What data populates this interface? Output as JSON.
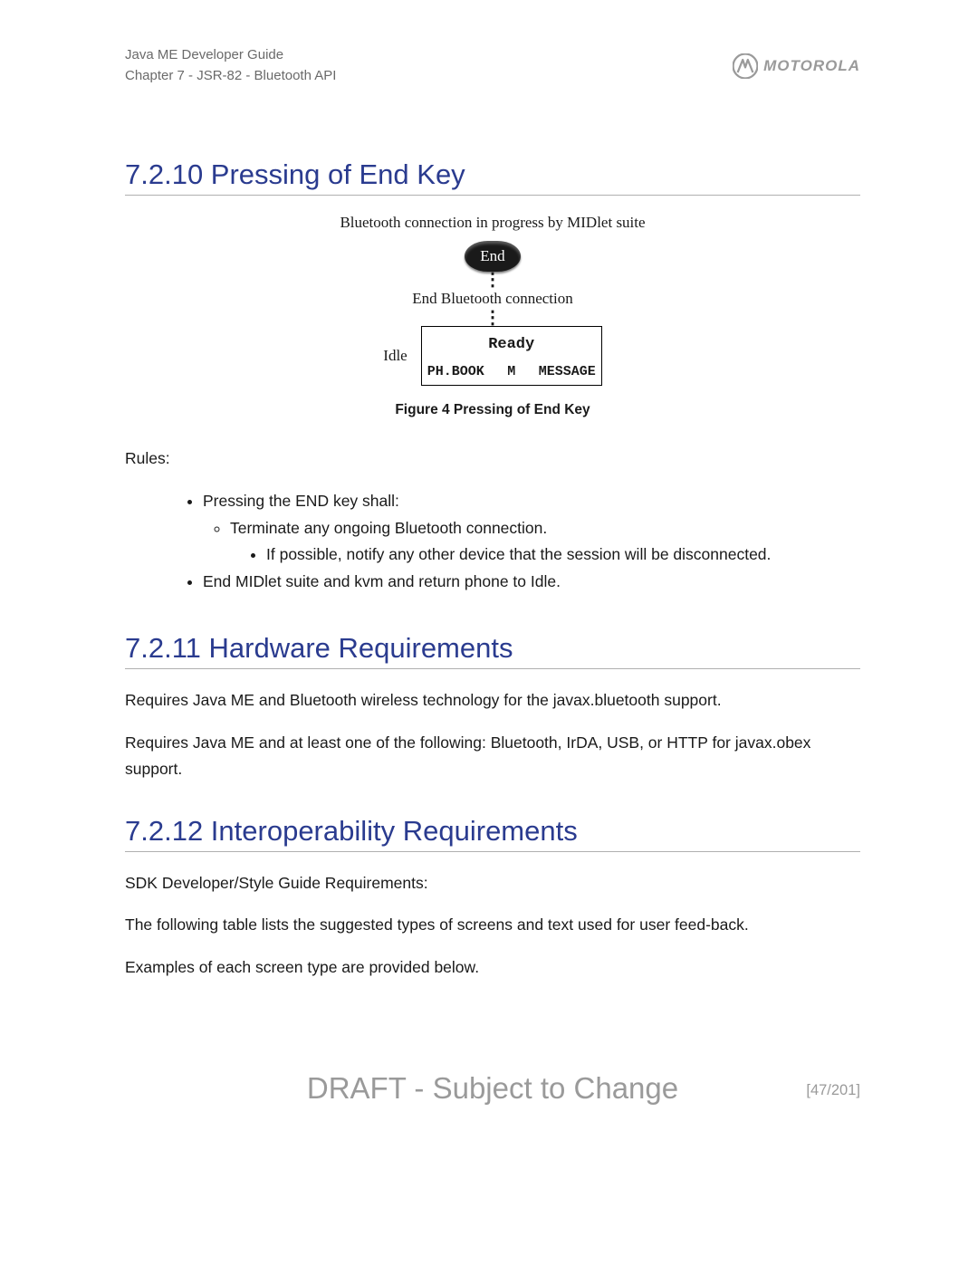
{
  "header": {
    "line1": "Java ME Developer Guide",
    "line2": "Chapter 7 - JSR-82 - Bluetooth API",
    "logo_text": "MOTOROLA"
  },
  "s1": {
    "heading": "7.2.10 Pressing of End Key",
    "fig_top": "Bluetooth connection in progress by MIDlet suite",
    "end_btn": "End",
    "fig_mid": "End Bluetooth connection",
    "idle": "Idle",
    "screen_r1": "Ready",
    "screen_r2a": "PH.BOOK",
    "screen_r2b": "M",
    "screen_r2c": "MESSAGE",
    "caption": "Figure 4 Pressing of End Key",
    "rules_label": "Rules:",
    "b1": "Pressing the END key shall:",
    "b1a": "Terminate any ongoing Bluetooth connection.",
    "b1a1": "If possible, notify any other device that the session will be disconnected.",
    "b2": "End MIDlet suite and kvm and return phone to Idle."
  },
  "s2": {
    "heading": "7.2.11 Hardware Requirements",
    "p1": "Requires Java ME and Bluetooth wireless technology for the javax.bluetooth support.",
    "p2": "Requires Java ME and at least one of the following: Bluetooth, IrDA, USB, or HTTP for javax.obex support."
  },
  "s3": {
    "heading": "7.2.12 Interoperability Requirements",
    "p1": "SDK Developer/Style Guide Requirements:",
    "p2": "The following table lists the suggested types of screens and text used for user feed-back.",
    "p3": "Examples of each screen type are provided below."
  },
  "footer": {
    "draft": "DRAFT - Subject to Change",
    "page": "[47/201]"
  }
}
